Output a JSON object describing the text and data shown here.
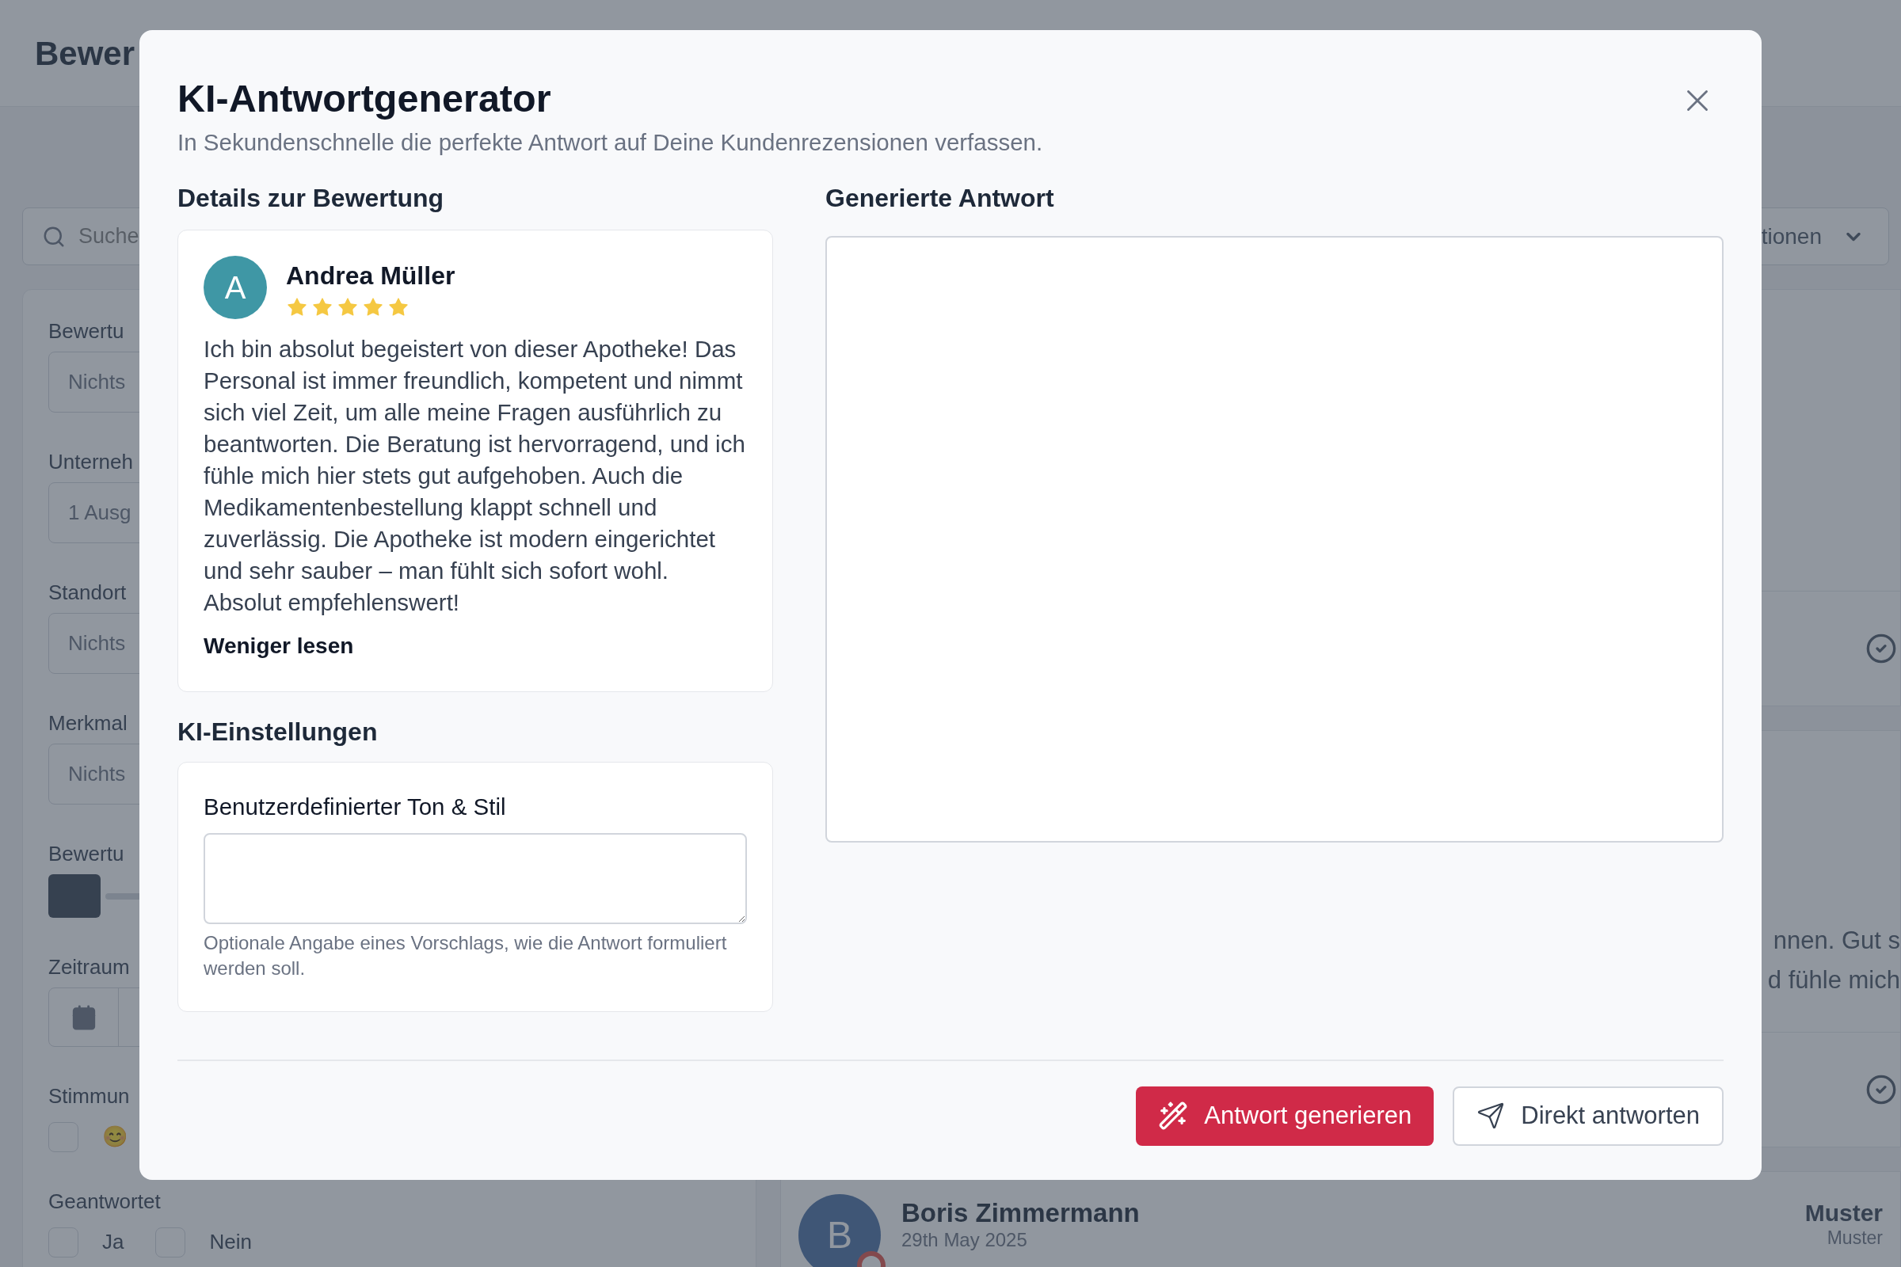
{
  "background": {
    "page_title": "Bewer",
    "search": {
      "placeholder": "Suche"
    },
    "actions_dropdown": "tionen",
    "filters": [
      {
        "label": "Bewertu",
        "kind": "select",
        "value": "Nichts"
      },
      {
        "label": "Unterneh",
        "kind": "select",
        "value": "1 Ausg"
      },
      {
        "label": "Standort",
        "kind": "select",
        "value": "Nichts"
      },
      {
        "label": "Merkmal",
        "kind": "select",
        "value": "Nichts"
      },
      {
        "label": "Bewertu",
        "kind": "segments",
        "segments": [
          {
            "selected": true
          },
          {
            "selected": false
          }
        ]
      },
      {
        "label": "Zeitraum",
        "kind": "date"
      },
      {
        "label": "Stimmun",
        "kind": "checkboxes",
        "options": [
          {
            "label": "😊",
            "checked": false
          }
        ]
      },
      {
        "label": "Geantwortet",
        "kind": "checkboxes",
        "options": [
          {
            "label": "Ja",
            "checked": false
          },
          {
            "label": "Nein",
            "checked": false
          }
        ]
      }
    ],
    "reviews": [
      {
        "kind": "card",
        "replied": true
      },
      {
        "kind": "card",
        "text_lines": [
          "nnen. Gut s",
          "d fühle mich"
        ],
        "replied": true
      },
      {
        "kind": "author",
        "initial": "B",
        "author": "Boris Zimmermann",
        "date": "29th May 2025",
        "location_lines": [
          "Muster",
          "Muster"
        ]
      }
    ]
  },
  "modal": {
    "title": "KI-Antwortgenerator",
    "subtitle": "In Sekundenschnelle die perfekte Antwort auf Deine Kundenrezensionen verfassen.",
    "review": {
      "heading": "Details zur Bewertung",
      "initial": "A",
      "author": "Andrea Müller",
      "stars": 5,
      "text": "Ich bin absolut begeistert von dieser Apotheke! Das Personal ist immer freundlich, kompetent und nimmt sich viel Zeit, um alle meine Fragen ausführlich zu beantworten. Die Beratung ist hervorragend, und ich fühle mich hier stets gut aufgehoben. Auch die Medikamentenbestellung klappt schnell und zuverlässig. Die Apotheke ist modern eingerichtet und sehr sauber – man fühlt sich sofort wohl. Absolut empfehlenswert!",
      "toggle_link": "Weniger lesen"
    },
    "settings": {
      "heading": "KI-Einstellungen",
      "field_label": "Benutzerdefinierter Ton & Stil",
      "hint": "Optionale Angabe eines Vorschlags, wie die Antwort formuliert werden soll."
    },
    "generated": {
      "heading": "Generierte Antwort"
    },
    "buttons": [
      {
        "kind": "primary",
        "label": "Antwort generieren"
      },
      {
        "kind": "secondary",
        "label": "Direkt antworten"
      }
    ]
  }
}
